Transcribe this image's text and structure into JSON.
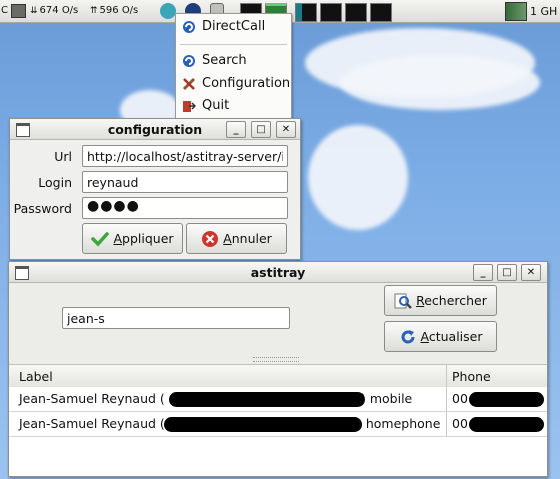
{
  "panel": {
    "left_partial": "C",
    "download_rate": "674 O/s",
    "upload_rate": "596 O/s",
    "cpu_partial": "1 GH"
  },
  "menu": {
    "items": [
      {
        "label": "DirectCall",
        "icon": "phone-app-icon"
      },
      {
        "label": "Search",
        "icon": "app-swirl-icon"
      },
      {
        "label": "Configuration",
        "icon": "tools-icon"
      },
      {
        "label": "Quit",
        "icon": "quit-icon"
      }
    ]
  },
  "config_window": {
    "title": "configuration",
    "url_label": "Url",
    "url_value": "http://localhost/astitray-server/in",
    "login_label": "Login",
    "login_value": "reynaud",
    "password_label": "Password",
    "password_value": "●●●●",
    "apply_pre": "",
    "apply_mnemonic": "A",
    "apply_post": "ppliquer",
    "cancel_pre": "",
    "cancel_mnemonic": "A",
    "cancel_post": "nnuler"
  },
  "main_window": {
    "title": "astitray",
    "search_value": "jean-s",
    "search_btn_mnemonic": "R",
    "search_btn_post": "echercher",
    "refresh_btn_mnemonic": "A",
    "refresh_btn_post": "ctualiser",
    "columns": [
      "Label",
      "Phone"
    ],
    "rows": [
      {
        "name_prefix": "Jean-Samuel Reynaud (",
        "type": ") mobile",
        "phone_prefix": "00"
      },
      {
        "name_prefix": "Jean-Samuel Reynaud (",
        "type": ") homephone",
        "phone_prefix": "00"
      }
    ]
  },
  "colors": {
    "sky": "#7eaee6",
    "ok_green": "#3da63a",
    "cancel_red": "#d0342c",
    "app_blue": "#2b5fb8"
  }
}
